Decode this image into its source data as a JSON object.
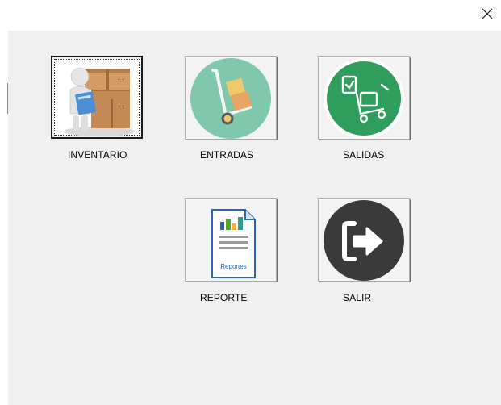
{
  "window": {
    "close_glyph": "✕"
  },
  "menu": {
    "buttons": [
      {
        "id": "inventario",
        "label": "INVENTARIO",
        "icon": "inventory-boxes-icon"
      },
      {
        "id": "entradas",
        "label": "ENTRADAS",
        "icon": "hand-truck-icon"
      },
      {
        "id": "salidas",
        "label": "SALIDAS",
        "icon": "checklist-cart-icon"
      },
      {
        "id": "reporte",
        "label": "REPORTE",
        "icon": "report-document-icon",
        "icon_caption": "Reportes"
      },
      {
        "id": "salir",
        "label": "SALIR",
        "icon": "exit-arrow-icon"
      }
    ]
  },
  "colors": {
    "panel_bg": "#f0f0f0",
    "entradas_circle": "#7fc8ae",
    "salidas_circle": "#2f9e5c",
    "salir_circle": "#3a3a3a",
    "report_blue": "#2d64b6"
  }
}
